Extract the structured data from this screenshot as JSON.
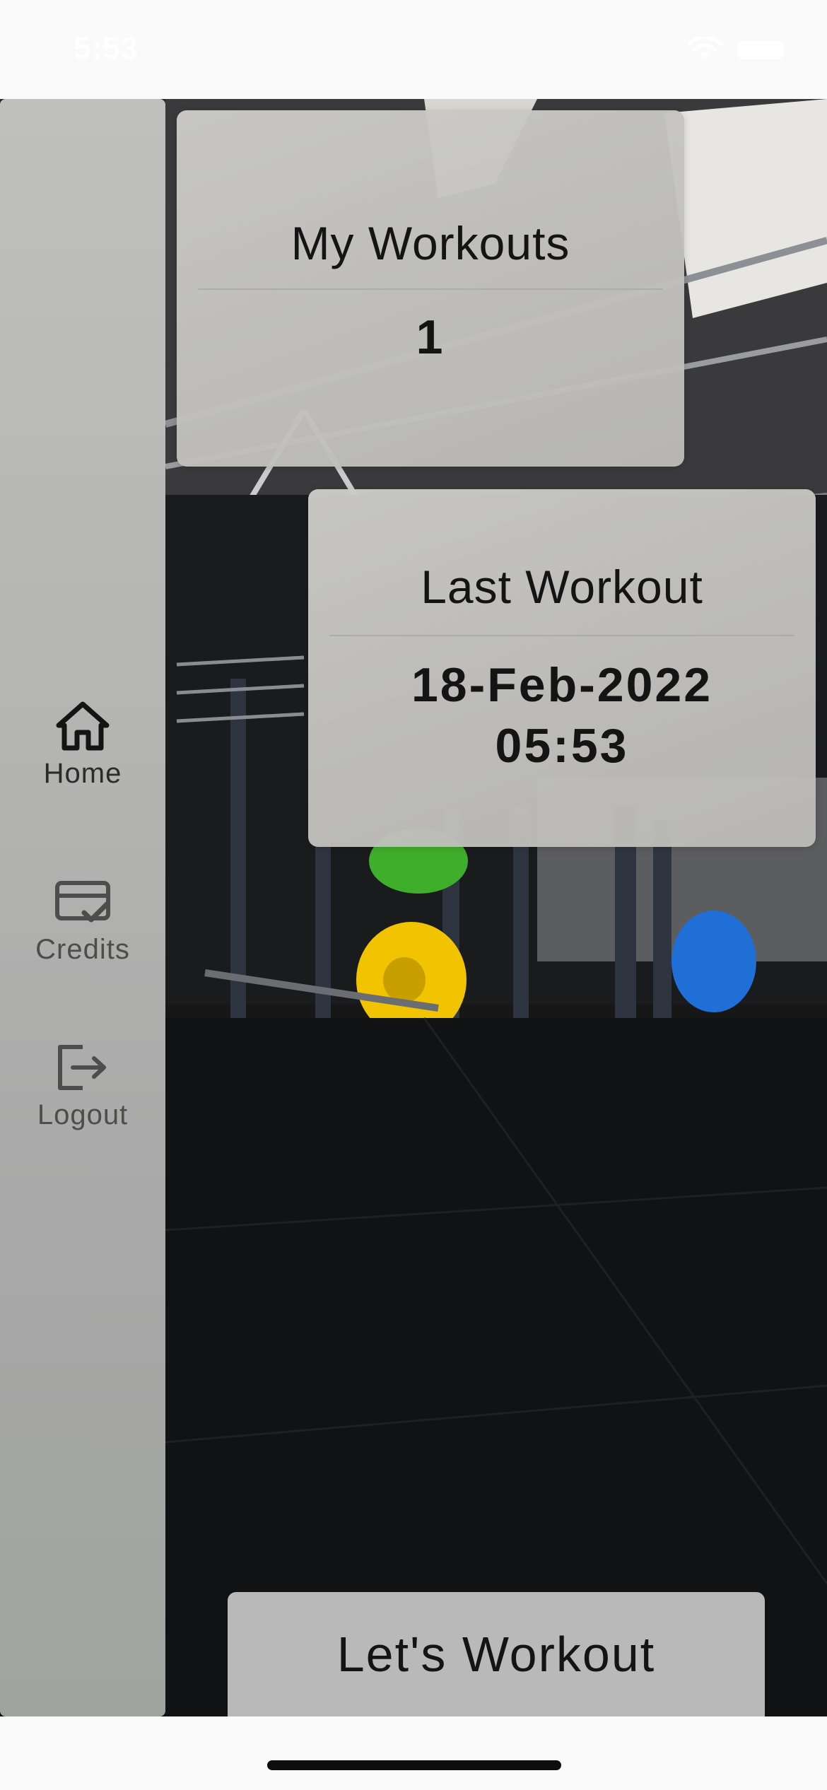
{
  "status_bar": {
    "time": "5:53",
    "wifi_icon": "wifi-icon",
    "battery_icon": "battery-icon"
  },
  "side_nav": {
    "items": [
      {
        "label": "Home",
        "icon": "home-icon",
        "active": true
      },
      {
        "label": "Credits",
        "icon": "credit-card-check-icon",
        "active": false
      },
      {
        "label": "Logout",
        "icon": "logout-icon",
        "active": false
      }
    ]
  },
  "cards": {
    "my_workouts": {
      "title": "My Workouts",
      "value": "1"
    },
    "last_workout": {
      "title": "Last Workout",
      "date": "18-Feb-2022",
      "time": "05:53"
    }
  },
  "actions": {
    "start_workout_label": "Let's Workout"
  },
  "colors": {
    "weight_plate_green": "#3fae2a",
    "weight_plate_yellow": "#f2c300",
    "weight_plate_red": "#e0202c",
    "weight_plate_blue": "#1f6fd6"
  }
}
